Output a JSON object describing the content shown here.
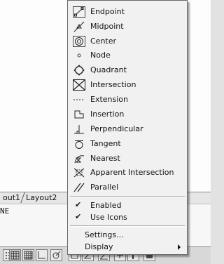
{
  "tabs": {
    "tab1": "out1",
    "tab2": "Layout2"
  },
  "command_line": {
    "text": "NE"
  },
  "menu": {
    "items": [
      {
        "label": "Endpoint",
        "icon": "endpoint-icon"
      },
      {
        "label": "Midpoint",
        "icon": "midpoint-icon"
      },
      {
        "label": "Center",
        "icon": "center-icon"
      },
      {
        "label": "Node",
        "icon": "node-icon"
      },
      {
        "label": "Quadrant",
        "icon": "quadrant-icon"
      },
      {
        "label": "Intersection",
        "icon": "intersection-icon"
      },
      {
        "label": "Extension",
        "icon": "extension-icon"
      },
      {
        "label": "Insertion",
        "icon": "insertion-icon"
      },
      {
        "label": "Perpendicular",
        "icon": "perpendicular-icon"
      },
      {
        "label": "Tangent",
        "icon": "tangent-icon"
      },
      {
        "label": "Nearest",
        "icon": "nearest-icon"
      },
      {
        "label": "Apparent Intersection",
        "icon": "apparent-intersection-icon"
      },
      {
        "label": "Parallel",
        "icon": "parallel-icon"
      }
    ],
    "enabled": {
      "label": "Enabled",
      "checked": true
    },
    "use_icons": {
      "label": "Use Icons",
      "checked": true
    },
    "settings": {
      "label": "Settings..."
    },
    "display": {
      "label": "Display"
    },
    "check_mark": "✔"
  }
}
